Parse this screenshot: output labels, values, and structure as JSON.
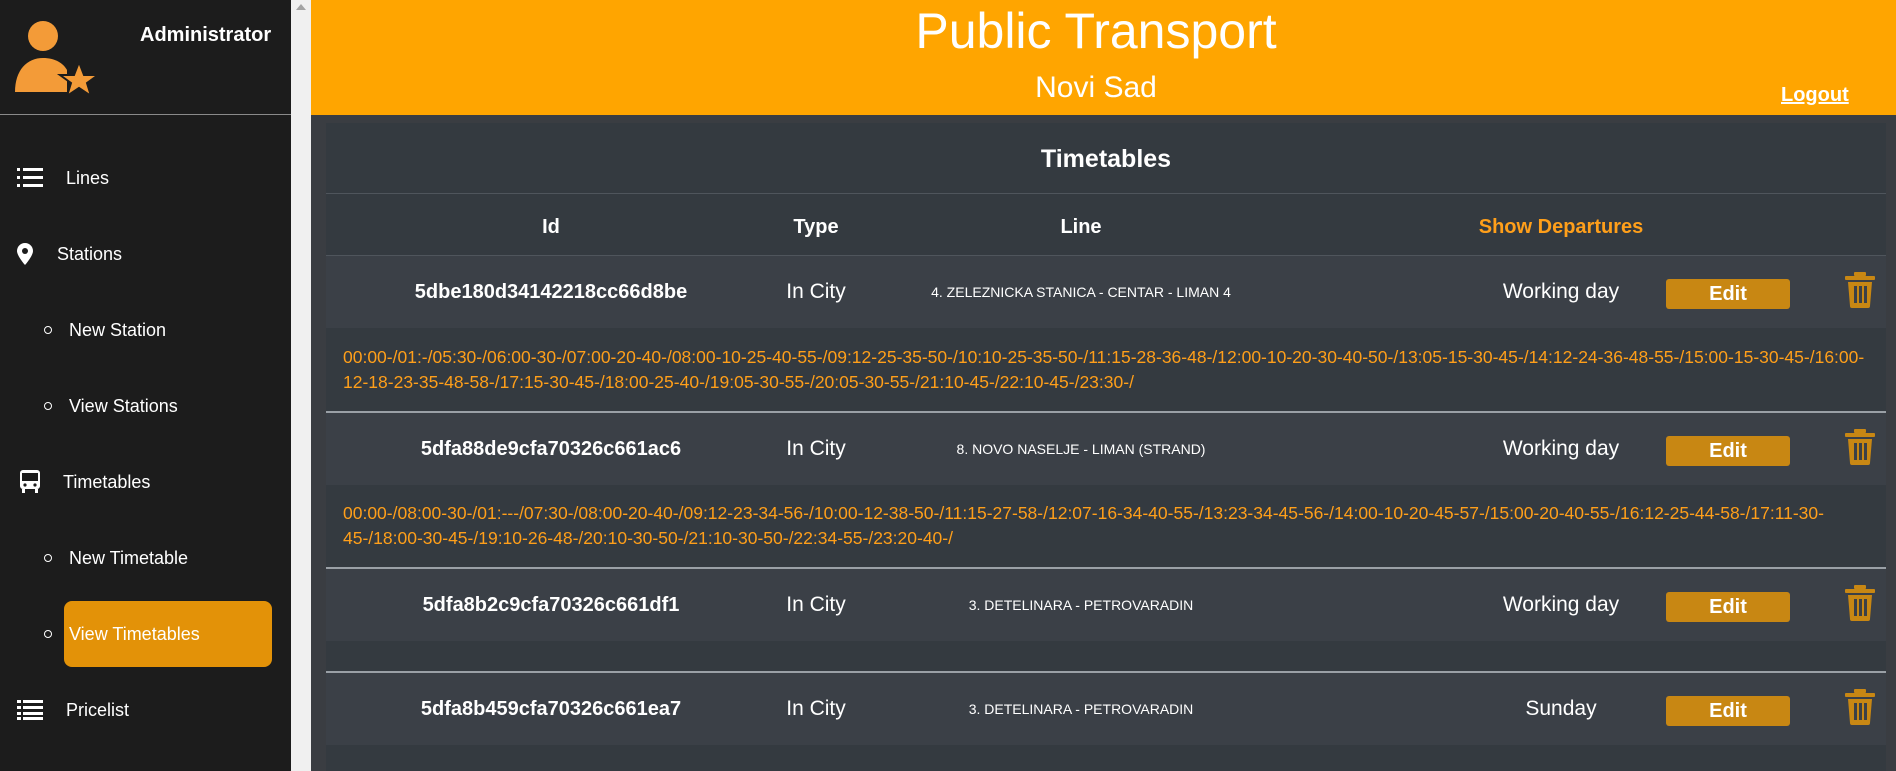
{
  "sidebar": {
    "user_title": "Administrator",
    "items": [
      {
        "label": "Lines",
        "icon": "list-icon"
      },
      {
        "label": "Stations",
        "icon": "map-pin-icon"
      },
      {
        "label": "New Station",
        "icon": "bullet-icon"
      },
      {
        "label": "View Stations",
        "icon": "bullet-icon"
      },
      {
        "label": "Timetables",
        "icon": "bus-icon"
      },
      {
        "label": "New Timetable",
        "icon": "bullet-icon"
      },
      {
        "label": "View Timetables",
        "icon": "bullet-icon",
        "active": true
      },
      {
        "label": "Pricelist",
        "icon": "list-icon"
      }
    ]
  },
  "header": {
    "title": "Public Transport",
    "subtitle": "Novi Sad",
    "logout": "Logout"
  },
  "main": {
    "title": "Timetables",
    "columns": [
      "Id",
      "Type",
      "Line",
      "Show Departures"
    ],
    "rows": [
      {
        "id": "5dbe180d34142218cc66d8be",
        "type": "In City",
        "line": "4. ZELEZNICKA STANICA - CENTAR - LIMAN 4",
        "day": "Working day",
        "edit": "Edit",
        "departures": "00:00-/01:-/05:30-/06:00-30-/07:00-20-40-/08:00-10-25-40-55-/09:12-25-35-50-/10:10-25-35-50-/11:15-28-36-48-/12:00-10-20-30-40-50-/13:05-15-30-45-/14:12-24-36-48-55-/15:00-15-30-45-/16:00-12-18-23-35-48-58-/17:15-30-45-/18:00-25-40-/19:05-30-55-/20:05-30-55-/21:10-45-/22:10-45-/23:30-/"
      },
      {
        "id": "5dfa88de9cfa70326c661ac6",
        "type": "In City",
        "line": "8. NOVO NASELJE - LIMAN (STRAND)",
        "day": "Working day",
        "edit": "Edit",
        "departures": "00:00-/08:00-30-/01:---/07:30-/08:00-20-40-/09:12-23-34-56-/10:00-12-38-50-/11:15-27-58-/12:07-16-34-40-55-/13:23-34-45-56-/14:00-10-20-45-57-/15:00-20-40-55-/16:12-25-44-58-/17:11-30-45-/18:00-30-45-/19:10-26-48-/20:10-30-50-/21:10-30-50-/22:34-55-/23:20-40-/"
      },
      {
        "id": "5dfa8b2c9cfa70326c661df1",
        "type": "In City",
        "line": "3. DETELINARA - PETROVARADIN",
        "day": "Working day",
        "edit": "Edit",
        "departures": ""
      },
      {
        "id": "5dfa8b459cfa70326c661ea7",
        "type": "In City",
        "line": "3. DETELINARA - PETROVARADIN",
        "day": "Sunday",
        "edit": "Edit",
        "departures": ""
      }
    ]
  },
  "colors": {
    "accent": "#ffa500",
    "sidebar_bg": "#1c1c1c",
    "active_item": "#e39208",
    "panel_bg": "#343a40",
    "button": "#c88713",
    "departures_text": "#ff9f1a"
  }
}
